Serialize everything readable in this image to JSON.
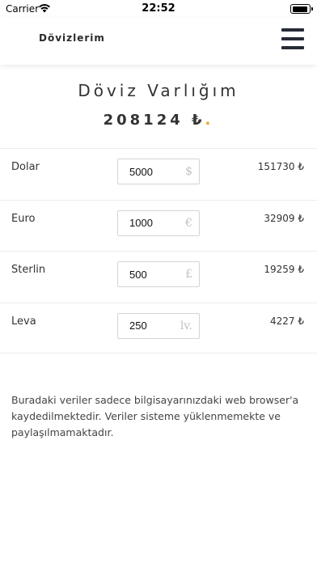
{
  "status_bar": {
    "carrier": "Carrier",
    "time": "22:52"
  },
  "navbar": {
    "brand": "Dövizlerim",
    "menu_icon": "hamburger-menu-icon"
  },
  "summary": {
    "title": "Döviz Varlığım",
    "total": "208124 ₺",
    "total_dot": ".",
    "accent_color": "#e8a317"
  },
  "rates": [
    {
      "name": "Dolar",
      "amount": "5000",
      "unit": "$",
      "value": "151730 ₺"
    },
    {
      "name": "Euro",
      "amount": "1000",
      "unit": "€",
      "value": "32909 ₺"
    },
    {
      "name": "Sterlin",
      "amount": "500",
      "unit": "£",
      "value": "19259 ₺"
    },
    {
      "name": "Leva",
      "amount": "250",
      "unit": "lv.",
      "value": "4227 ₺"
    }
  ],
  "note": "Buradaki veriler sadece bilgisayarınızdaki web browser'a kaydedilmektedir. Veriler sisteme yüklenmemekte ve paylaşılmamaktadır."
}
